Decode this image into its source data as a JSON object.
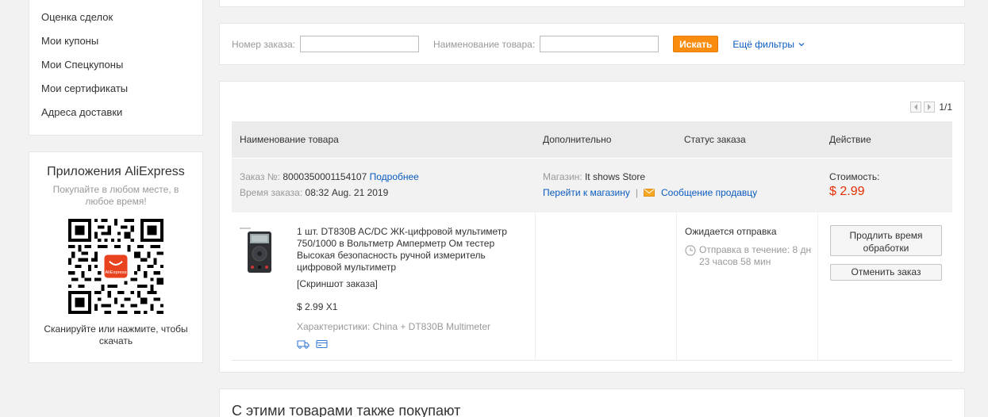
{
  "sidebar": {
    "items": [
      {
        "label": "Оценка сделок"
      },
      {
        "label": "Мои купоны"
      },
      {
        "label": "Мои Спецкупоны"
      },
      {
        "label": "Мои сертификаты"
      },
      {
        "label": "Адреса доставки"
      }
    ]
  },
  "app_promo": {
    "title": "Приложения AliExpress",
    "subtitle": "Покупайте в любом месте, в любое время!",
    "hint": "Сканируйте или нажмите, чтобы скачать",
    "badge": "AliExpress"
  },
  "search": {
    "order_number_label": "Номер заказа:",
    "product_name_label": "Наименование товара:",
    "search_button": "Искать",
    "more_filters": "Ещё фильтры"
  },
  "pager": {
    "text": "1/1"
  },
  "table": {
    "headers": {
      "product": "Наименование товара",
      "extra": "Дополнительно",
      "status": "Статус заказа",
      "action": "Действие"
    }
  },
  "order": {
    "number_label": "Заказ №:",
    "number": "8000350001154107",
    "details_link": "Подробнее",
    "time_label": "Время заказа:",
    "time": "08:32 Aug. 21 2019",
    "store_label": "Магазин:",
    "store_name": "It shows Store",
    "go_to_store": "Перейти к магазину",
    "separator": "|",
    "message_seller": "Сообщение продавцу",
    "cost_label": "Стоимость:",
    "cost": "$ 2.99",
    "product_title": "1 шт. DT830B AC/DC ЖК-цифровой мультиметр 750/1000 в Вольтметр Амперметр Ом тестер Высокая безопасность ручной измеритель цифровой мультиметр",
    "snapshot": "[Скриншот заказа]",
    "price_qty": "$ 2.99 X1",
    "characteristics": "Характеристики: China + DT830B Multimeter",
    "status": "Ожидается отправка",
    "countdown": "Отправка в течение: 8 дн 23 часов 58 мин",
    "extend_button": "Продлить время обработки",
    "cancel_button": "Отменить заказ"
  },
  "recommend": {
    "title": "С этими товарами также покупают"
  },
  "colors": {
    "accent": "#fa8c0f",
    "link": "#0a5bbf",
    "price": "#e62e04"
  }
}
